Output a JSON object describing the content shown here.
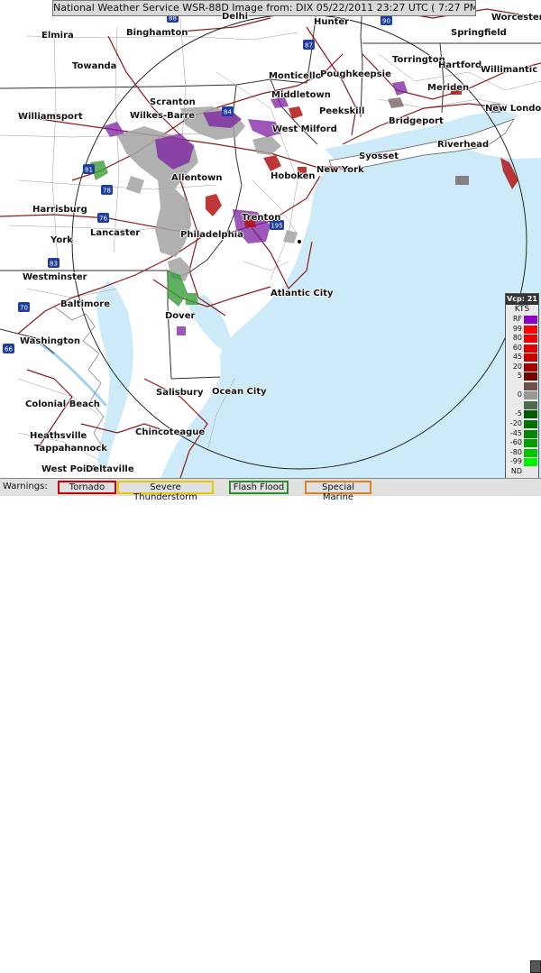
{
  "title": "National Weather Service WSR-88D Image from: DIX 05/22/2011  23:27 UTC  ( 7:27 PM EDT)",
  "cities": [
    {
      "name": "Worcester"
    },
    {
      "name": "Elmira"
    },
    {
      "name": "Binghamton"
    },
    {
      "name": "Delhi"
    },
    {
      "name": "Hunter"
    },
    {
      "name": "Springfield"
    },
    {
      "name": "Towanda"
    },
    {
      "name": "Monticello"
    },
    {
      "name": "Poughkeepsie"
    },
    {
      "name": "Torrington"
    },
    {
      "name": "Hartford"
    },
    {
      "name": "Willimantic"
    },
    {
      "name": "Scranton"
    },
    {
      "name": "Middletown"
    },
    {
      "name": "Meriden"
    },
    {
      "name": "Williamsport"
    },
    {
      "name": "Wilkes-Barre"
    },
    {
      "name": "Peekskill"
    },
    {
      "name": "New London"
    },
    {
      "name": "Bridgeport"
    },
    {
      "name": "West Milford"
    },
    {
      "name": "Riverhead"
    },
    {
      "name": "Syosset"
    },
    {
      "name": "Hoboken"
    },
    {
      "name": "New York"
    },
    {
      "name": "Allentown"
    },
    {
      "name": "Harrisburg"
    },
    {
      "name": "Trenton"
    },
    {
      "name": "Lancaster"
    },
    {
      "name": "Philadelphia"
    },
    {
      "name": "York"
    },
    {
      "name": "Westminster"
    },
    {
      "name": "Atlantic City"
    },
    {
      "name": "Baltimore"
    },
    {
      "name": "Dover"
    },
    {
      "name": "Washington"
    },
    {
      "name": "Salisbury"
    },
    {
      "name": "Ocean City"
    },
    {
      "name": "Colonial Beach"
    },
    {
      "name": "Chincoteague"
    },
    {
      "name": "Heathsville"
    },
    {
      "name": "Tappahannock"
    },
    {
      "name": "West Point"
    },
    {
      "name": "Deltaville"
    }
  ],
  "legend": {
    "header": "Vcp: 21",
    "unit": "KTS",
    "rows": [
      {
        "label": "RF",
        "color": "#8b00c9"
      },
      {
        "label": "99",
        "color": "#ff0000"
      },
      {
        "label": "80",
        "color": "#ef0000"
      },
      {
        "label": "60",
        "color": "#dc0000"
      },
      {
        "label": "45",
        "color": "#c80000"
      },
      {
        "label": "20",
        "color": "#a40000"
      },
      {
        "label": "5",
        "color": "#770000"
      },
      {
        "label": "",
        "color": "#6a4f4f"
      },
      {
        "label": "0",
        "color": "#979797"
      },
      {
        "label": "",
        "color": "#4c6a4c"
      },
      {
        "label": "-5",
        "color": "#005a00"
      },
      {
        "label": "-20",
        "color": "#006e00"
      },
      {
        "label": "-45",
        "color": "#008600"
      },
      {
        "label": "-60",
        "color": "#00a000"
      },
      {
        "label": "-80",
        "color": "#00c200"
      },
      {
        "label": "-99",
        "color": "#00f000"
      },
      {
        "label": "ND",
        "color": "#e8e8e8"
      }
    ]
  },
  "warnings": {
    "label": "Warnings:",
    "items": [
      {
        "label": "Tornado",
        "color": "#cc0000"
      },
      {
        "label": "Severe Thunderstorm",
        "color": "#e8c800"
      },
      {
        "label": "Flash Flood",
        "color": "#2e8b2e"
      },
      {
        "label": "Special Marine",
        "color": "#e08020"
      }
    ]
  },
  "highway_shields": [
    "88",
    "90",
    "87",
    "84",
    "81",
    "78",
    "76",
    "195",
    "83",
    "70",
    "66"
  ]
}
